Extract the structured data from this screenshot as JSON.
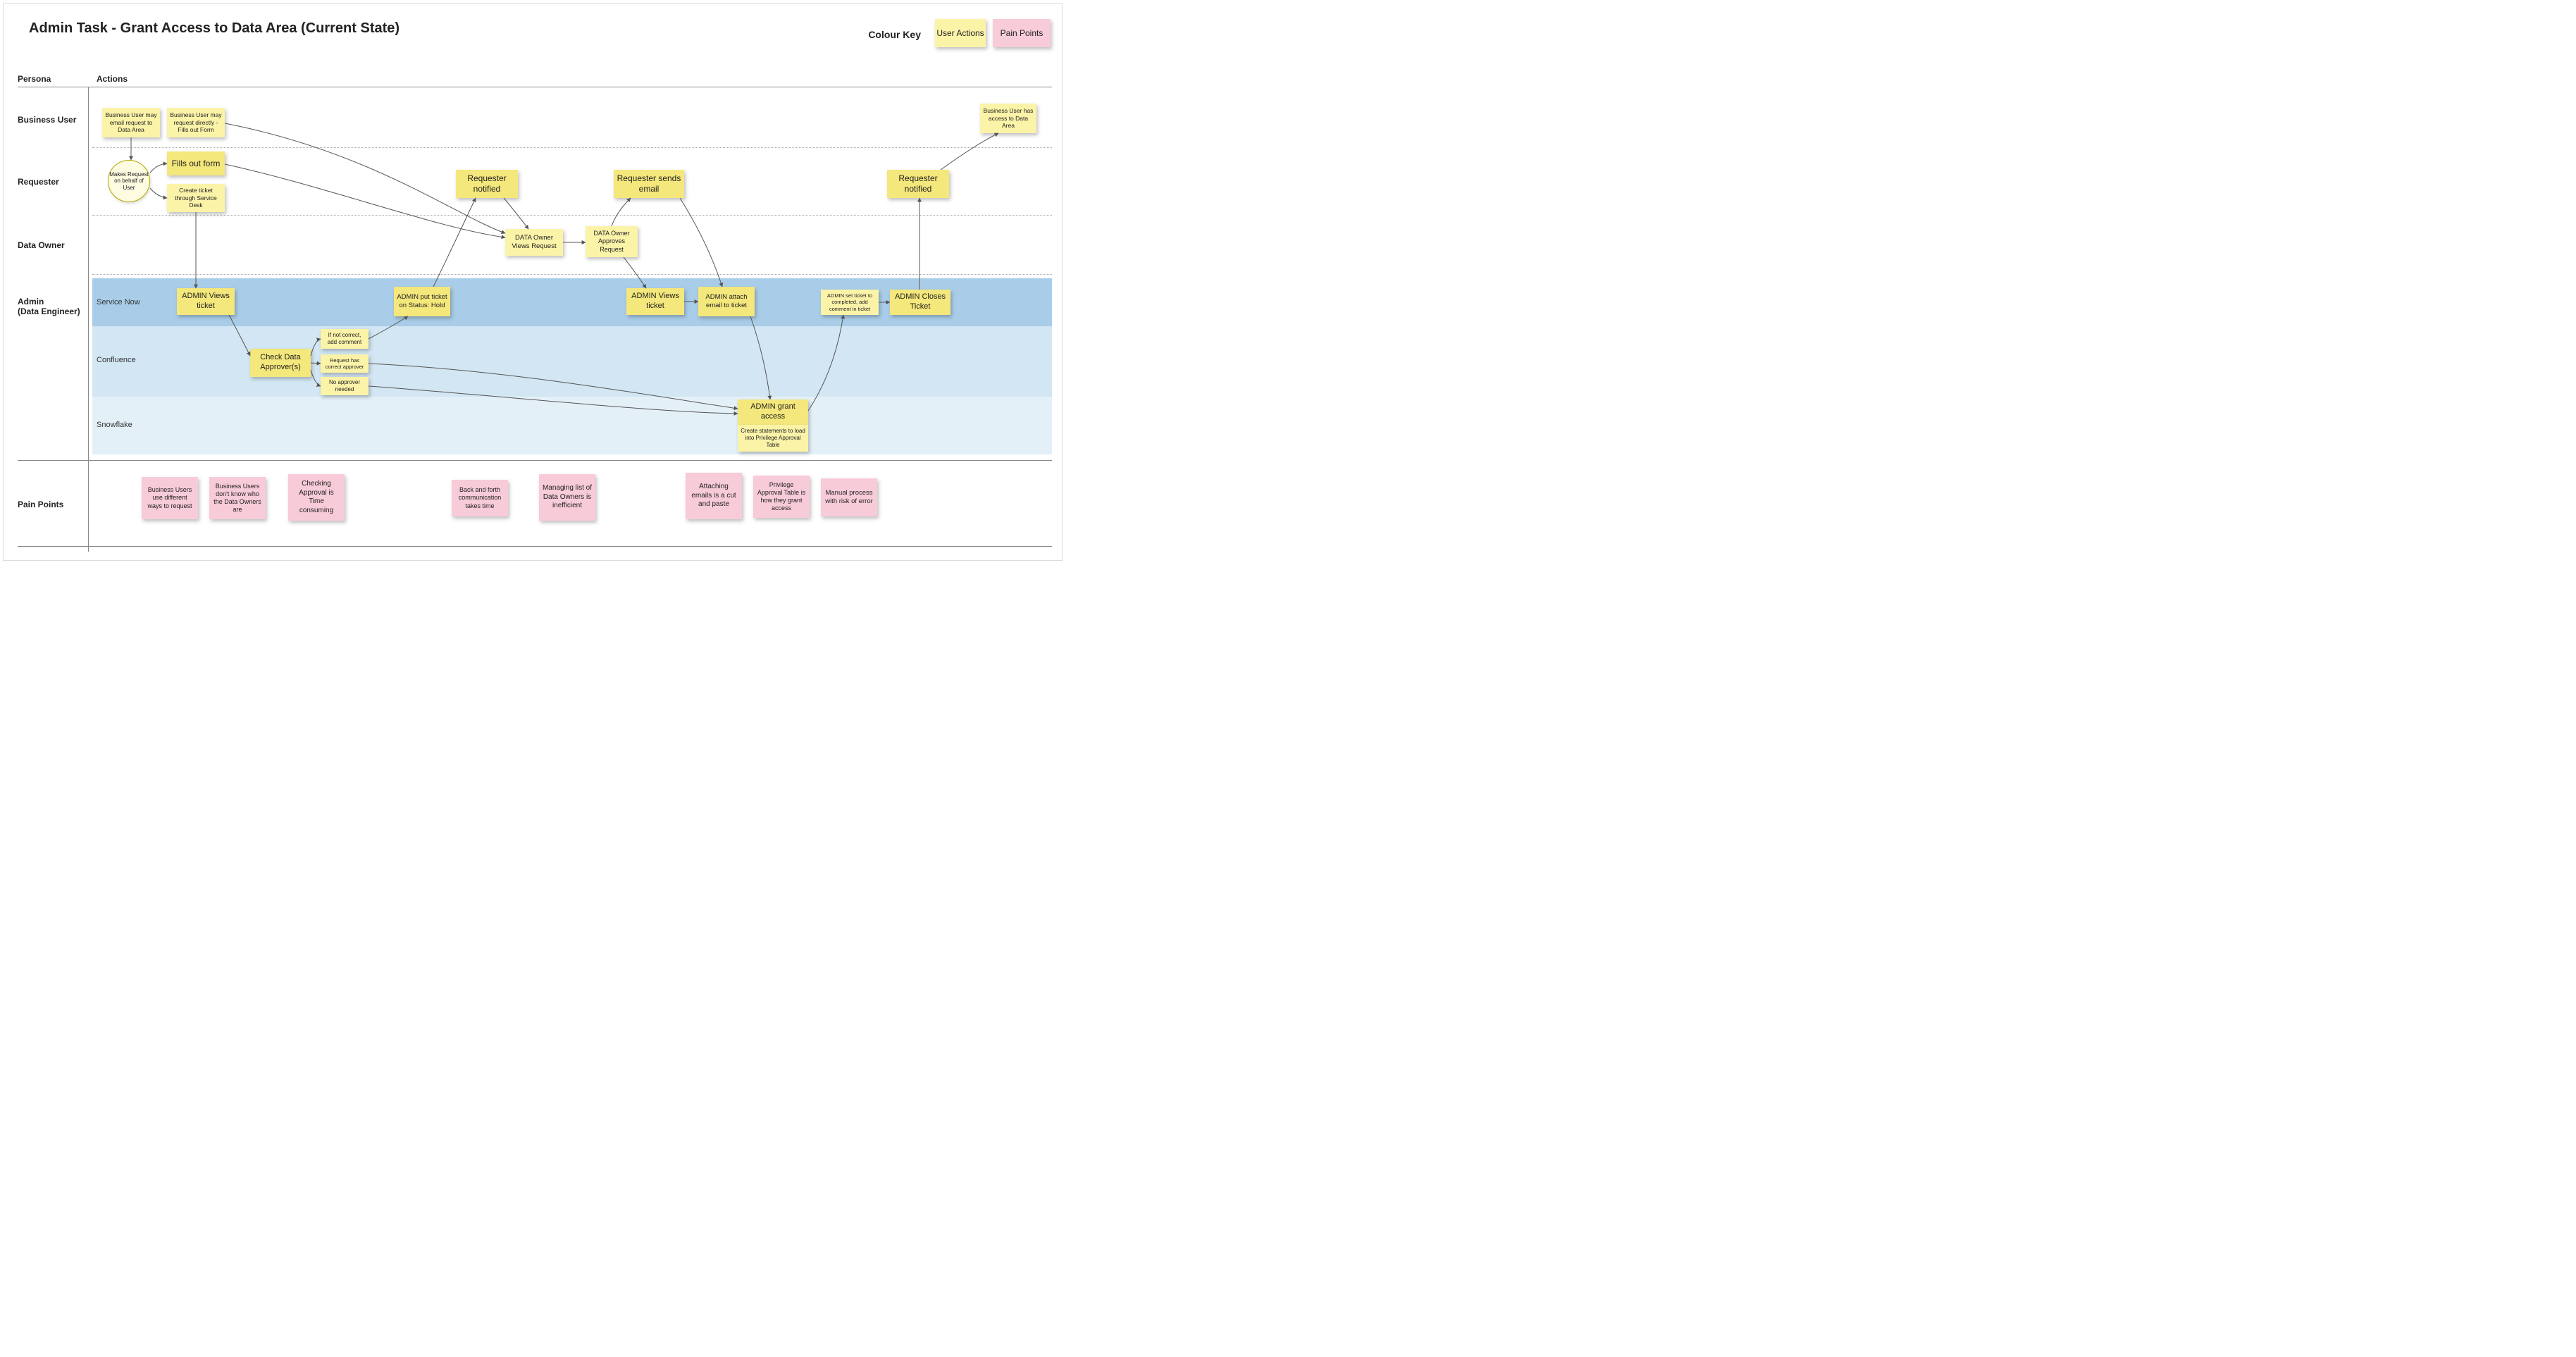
{
  "title": "Admin Task - Grant Access to Data Area (Current State)",
  "legend": {
    "label": "Colour Key",
    "user_actions": "User Actions",
    "pain_points": "Pain Points"
  },
  "columns": {
    "persona": "Persona",
    "actions": "Actions"
  },
  "lanes": {
    "business_user": "Business User",
    "requester": "Requester",
    "data_owner": "Data Owner",
    "admin_line1": "Admin",
    "admin_line2": "(Data Engineer)",
    "pain_points": "Pain Points"
  },
  "admin_rows": {
    "service_now": "Service Now",
    "confluence": "Confluence",
    "snowflake": "Snowflake"
  },
  "nodes": {
    "bu_email": "Business User may email request to Data Area",
    "bu_direct": "Business User may request directly - Fills out Form",
    "bu_access": "Business User has access to Data Area",
    "req_circle": "Makes Request on behalf of User",
    "req_form": "Fills out form",
    "req_ticket": "Create ticket through Service Desk",
    "req_notified1": "Requester notified",
    "req_email": "Requester sends email",
    "req_notified2": "Requester notified",
    "do_view": "DATA Owner Views Request",
    "do_approve": "DATA Owner Approves Request",
    "ad_view1": "ADMIN Views ticket",
    "ad_hold": "ADMIN put ticket on Status: Hold",
    "ad_view2": "ADMIN Views ticket",
    "ad_attach": "ADMIN attach email to ticket",
    "ad_complete": "ADMIN set ticket to completed, add comment in ticket",
    "ad_close": "ADMIN Closes Ticket",
    "check_approver": "Check Data Approver(s)",
    "branch_notcorrect": "If not correct, add comment",
    "branch_correct": "Request has correct approver",
    "branch_none": "No approver needed",
    "grant_title": "ADMIN grant access",
    "grant_sub": "Create statements to load into Privilege Approval Table"
  },
  "pain": {
    "p1": "Business Users use different ways to request",
    "p2": "Business Users don't know who the Data Owners are",
    "p3": "Checking Approval is Time consuming",
    "p4": "Back and forth communication takes time",
    "p5": "Managing list of Data Owners is inefficient",
    "p6": "Attaching emails is a cut and paste",
    "p7": "Privilege Approval Table is how they grant access",
    "p8": "Manual process with risk of  error"
  }
}
